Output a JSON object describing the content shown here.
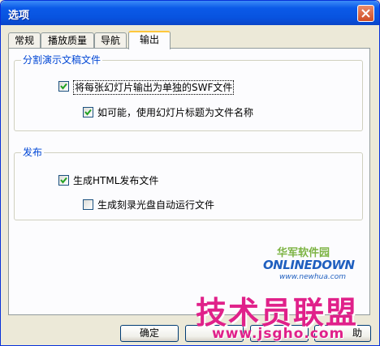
{
  "window": {
    "title": "选项"
  },
  "tabs": [
    {
      "label": "常规",
      "active": false
    },
    {
      "label": "播放质量",
      "active": false
    },
    {
      "label": "导航",
      "active": false
    },
    {
      "label": "输出",
      "active": true
    }
  ],
  "groups": {
    "split": {
      "title": "分割演示文稿文件",
      "options": [
        {
          "label": "将每张幻灯片输出为单独的SWF文件",
          "checked": true
        },
        {
          "label": "如可能，使用幻灯片标题为文件名称",
          "checked": true
        }
      ]
    },
    "publish": {
      "title": "发布",
      "options": [
        {
          "label": "生成HTML发布文件",
          "checked": true
        },
        {
          "label": "生成刻录光盘自动运行文件",
          "checked": false
        }
      ]
    }
  },
  "buttons": {
    "ok": "确定",
    "help": "助"
  },
  "watermark": {
    "brand_cn": "华军软件园",
    "brand_en": "ONLINEDOWN",
    "brand_url": "www.newhua.com",
    "site_cn": "技术员联盟",
    "site_url": "www.jsgho.com"
  },
  "colors": {
    "titlebar": "#0b5ae8",
    "group_title": "#0046d5",
    "active_tab_accent": "#ffc73c",
    "watermark": "#e0218a"
  }
}
